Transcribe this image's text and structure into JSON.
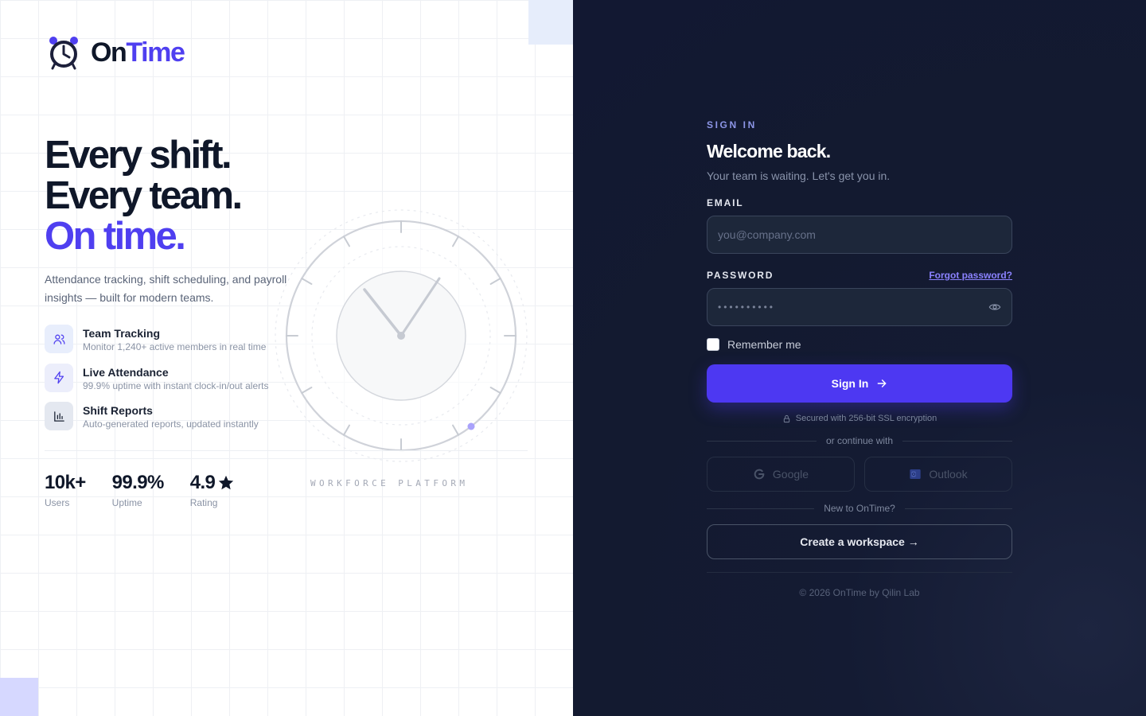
{
  "brand": {
    "name_part1": "On",
    "name_part2": "Time"
  },
  "hero": {
    "line1": "Every shift.",
    "line2": "Every team.",
    "line3": "On time.",
    "subtitle": "Attendance tracking, shift scheduling, and payroll insights — built for modern teams."
  },
  "features": [
    {
      "title": "Team Tracking",
      "desc": "Monitor 1,240+ active members in real time",
      "icon": "users-icon"
    },
    {
      "title": "Live Attendance",
      "desc": "99.9% uptime with instant clock-in/out alerts",
      "icon": "lightning-icon"
    },
    {
      "title": "Shift Reports",
      "desc": "Auto-generated reports, updated instantly",
      "icon": "bar-chart-icon"
    }
  ],
  "stats": [
    {
      "value": "10k+",
      "label": "Users"
    },
    {
      "value": "99.9%",
      "label": "Uptime"
    },
    {
      "value": "4.9",
      "label": "Rating",
      "icon": "star-icon"
    }
  ],
  "clock_caption": "WORKFORCE PLATFORM",
  "signin": {
    "eyebrow": "SIGN IN",
    "title": "Welcome back.",
    "tagline": "Your team is waiting. Let's get you in.",
    "email_label": "EMAIL",
    "email_placeholder": "you@company.com",
    "password_label": "PASSWORD",
    "forgot_label": "Forgot password?",
    "password_mask": "••••••••••",
    "remember_label": "Remember me",
    "remember_checked": false,
    "submit_label": "Sign In",
    "secured_text": "Secured with 256-bit SSL encryption",
    "continue_text": "or continue with",
    "google_label": "Google",
    "outlook_label": "Outlook",
    "new_text": "New to OnTime?",
    "create_label": "Create a workspace →",
    "copyright": "© 2026 OnTime by Qilin Lab"
  },
  "colors": {
    "accent": "#4f3ff0",
    "dark_panel": "#131a30",
    "button": "#4d38f2",
    "link": "#8b82ff"
  }
}
